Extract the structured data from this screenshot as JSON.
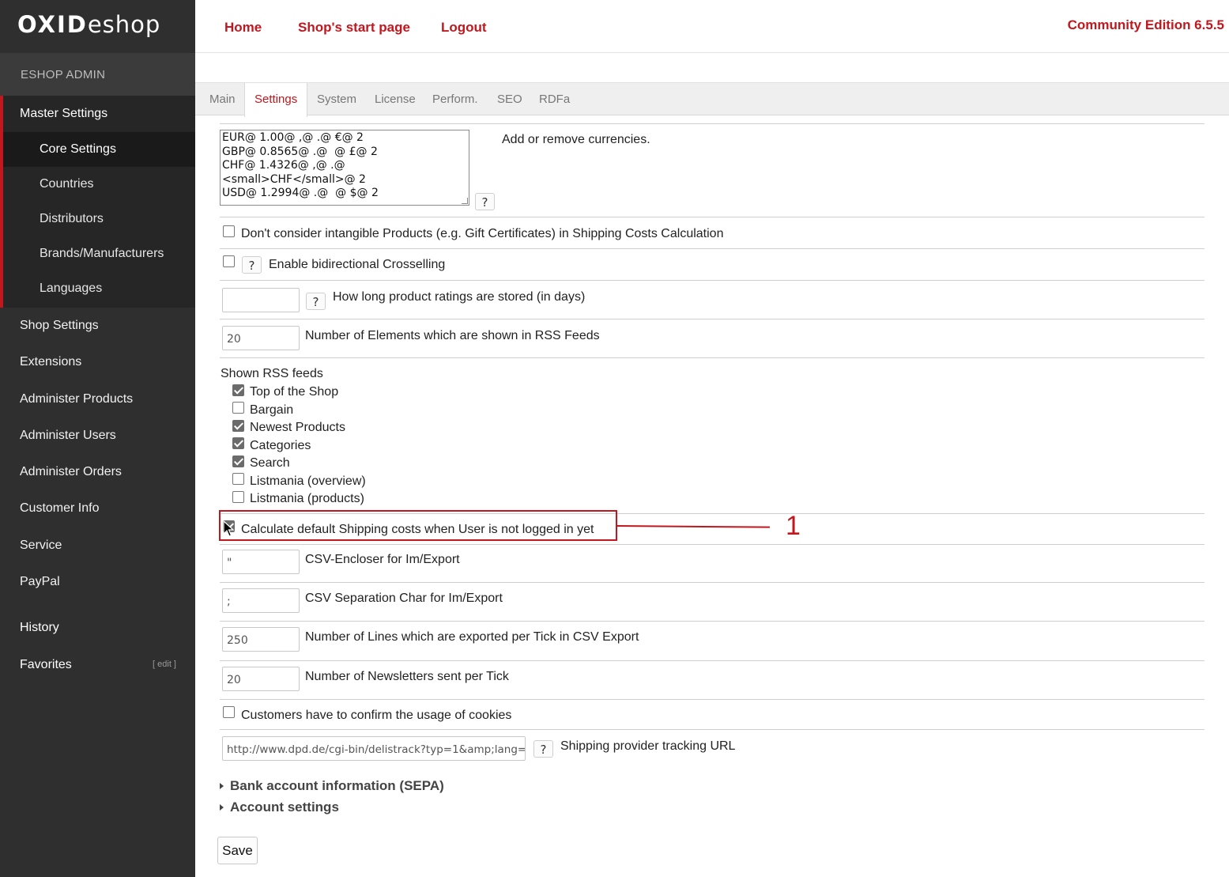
{
  "brand": {
    "logo_bold": "OXID",
    "logo_light": "eshop"
  },
  "sidebar": {
    "admin_label": "ESHOP ADMIN",
    "master_settings": "Master Settings",
    "sub_items": [
      {
        "label": "Core Settings",
        "active": true
      },
      {
        "label": "Countries"
      },
      {
        "label": "Distributors"
      },
      {
        "label": "Brands/Manufacturers"
      },
      {
        "label": "Languages"
      }
    ],
    "items": [
      "Shop Settings",
      "Extensions",
      "Administer Products",
      "Administer Users",
      "Administer Orders",
      "Customer Info",
      "Service",
      "PayPal"
    ],
    "history": "History",
    "favorites": "Favorites",
    "favorites_edit": "[ edit ]"
  },
  "topnav": {
    "home": "Home",
    "start_page": "Shop's start page",
    "logout": "Logout",
    "edition": "Community Edition 6.5.5"
  },
  "tabs": [
    "Main",
    "Settings",
    "System",
    "License",
    "Perform.",
    "SEO",
    "RDFa"
  ],
  "active_tab": "Settings",
  "settings": {
    "currencies": {
      "value": "EUR@ 1.00@ ,@ .@ €@ 2\nGBP@ 0.8565@ .@  @ £@ 2\nCHF@ 1.4326@ ,@ .@\n<small>CHF</small>@ 2\nUSD@ 1.2994@ .@  @ $@ 2",
      "label": "Add or remove currencies.",
      "help": "?"
    },
    "intangible": {
      "label": "Don't consider intangible Products (e.g. Gift Certificates) in Shipping Costs Calculation",
      "checked": false
    },
    "crossselling": {
      "label": "Enable bidirectional Crosselling",
      "checked": false,
      "help": "?"
    },
    "ratings_days": {
      "value": "",
      "label": "How long product ratings are stored (in days)",
      "help": "?"
    },
    "rss_count": {
      "value": "20",
      "label": "Number of Elements which are shown in RSS Feeds"
    },
    "rss_feeds": {
      "title": "Shown RSS feeds",
      "items": [
        {
          "label": "Top of the Shop",
          "checked": true
        },
        {
          "label": "Bargain",
          "checked": false
        },
        {
          "label": "Newest Products",
          "checked": true
        },
        {
          "label": "Categories",
          "checked": true
        },
        {
          "label": "Search",
          "checked": true
        },
        {
          "label": "Listmania (overview)",
          "checked": false
        },
        {
          "label": "Listmania (products)",
          "checked": false
        }
      ]
    },
    "default_shipping": {
      "label": "Calculate default Shipping costs when User is not logged in yet",
      "checked": true
    },
    "csv_encloser": {
      "value": "\"",
      "label": "CSV-Encloser for Im/Export"
    },
    "csv_separator": {
      "value": ";",
      "label": "CSV Separation Char for Im/Export"
    },
    "csv_lines": {
      "value": "250",
      "label": "Number of Lines which are exported per Tick in CSV Export"
    },
    "newsletters": {
      "value": "20",
      "label": "Number of Newsletters sent per Tick"
    },
    "cookies": {
      "label": "Customers have to confirm the usage of cookies",
      "checked": false
    },
    "tracking_url": {
      "value": "http://www.dpd.de/cgi-bin/delistrack?typ=1&amp;lang=",
      "label": "Shipping provider tracking URL",
      "help": "?"
    },
    "sections": [
      "Bank account information (SEPA)",
      "Account settings"
    ],
    "save": "Save"
  },
  "annotation": {
    "number": "1",
    "color": "#c0181e"
  },
  "colors": {
    "accent": "#c0181e",
    "sidebar": "#2f2f2f"
  }
}
